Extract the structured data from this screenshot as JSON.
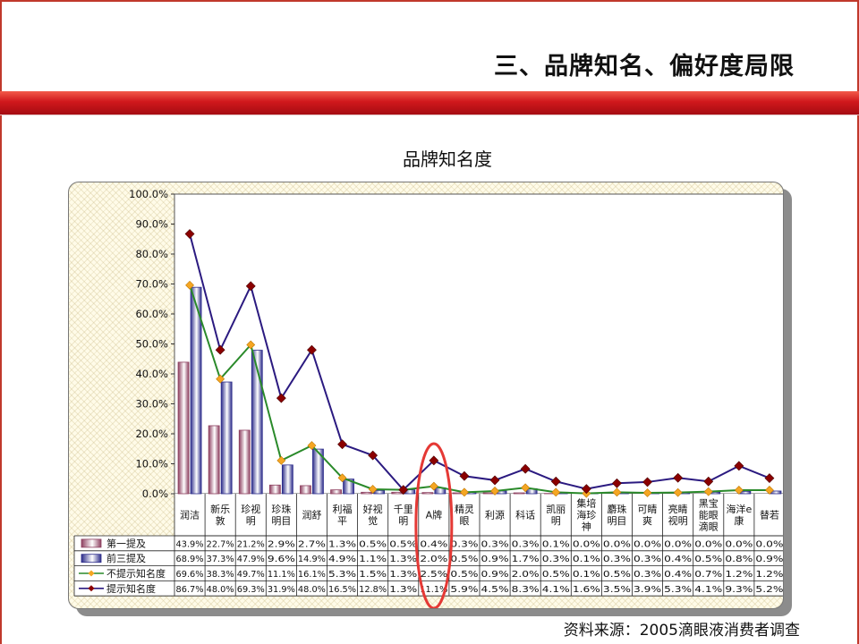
{
  "slide": {
    "title": "三、品牌知名、偏好度局限",
    "source": "资料来源：2005滴眼液消费者调查"
  },
  "colors": {
    "frame": "#c0392b",
    "title_bar": "#d0181c",
    "bar_first": "#8e4060",
    "bar_top3": "#2c2c8a",
    "line_unaided": "#2a8a2a",
    "marker_unaided": "#f5a623",
    "line_aided": "#2b1a80",
    "marker_aided": "#8b0000",
    "highlight": "#e53935"
  },
  "chart_data": {
    "type": "bar",
    "title": "品牌知名度",
    "categories": [
      "润洁",
      "新乐敦",
      "珍视明",
      "珍珠明目",
      "润舒",
      "利福平",
      "好视觉",
      "千里明",
      "A牌",
      "精灵眼",
      "利源",
      "科话",
      "凯丽明",
      "集培海珍神",
      "麝珠明目",
      "可睛爽",
      "亮睛视明",
      "黑宝能眼滴眼",
      "海洋e康",
      "替若"
    ],
    "category_lines": [
      [
        "润洁"
      ],
      [
        "新乐",
        "敦"
      ],
      [
        "珍视",
        "明"
      ],
      [
        "珍珠",
        "明目"
      ],
      [
        "润舒"
      ],
      [
        "利福",
        "平"
      ],
      [
        "好视",
        "觉"
      ],
      [
        "千里",
        "明"
      ],
      [
        "A牌"
      ],
      [
        "精灵",
        "眼"
      ],
      [
        "利源"
      ],
      [
        "科话"
      ],
      [
        "凯丽",
        "明"
      ],
      [
        "集培",
        "海珍",
        "神"
      ],
      [
        "麝珠",
        "明目"
      ],
      [
        "可睛",
        "爽"
      ],
      [
        "亮睛",
        "视明"
      ],
      [
        "黑宝",
        "能眼",
        "滴眼"
      ],
      [
        "海洋e",
        "康"
      ],
      [
        "替若"
      ]
    ],
    "ylim": [
      0,
      100
    ],
    "yticks": [
      "0.0%",
      "10.0%",
      "20.0%",
      "30.0%",
      "40.0%",
      "50.0%",
      "60.0%",
      "70.0%",
      "80.0%",
      "90.0%",
      "100.0%"
    ],
    "series": [
      {
        "name": "第一提及",
        "kind": "bar",
        "values": [
          43.9,
          22.7,
          21.2,
          2.9,
          2.7,
          1.3,
          0.5,
          0.5,
          0.4,
          0.3,
          0.3,
          0.3,
          0.1,
          0.0,
          0.0,
          0.0,
          0.0,
          0.0,
          0.0,
          0.0
        ],
        "labels": [
          "43.9%",
          "22.7%",
          "21.2%",
          "2.9%",
          "2.7%",
          "1.3%",
          "0.5%",
          "0.5%",
          "0.4%",
          "0.3%",
          "0.3%",
          "0.3%",
          "0.1%",
          "0.0%",
          "0.0%",
          "0.0%",
          "0.0%",
          "0.0%",
          "0.0%",
          "0.0%"
        ]
      },
      {
        "name": "前三提及",
        "kind": "bar",
        "values": [
          68.9,
          37.3,
          47.9,
          9.6,
          14.9,
          4.9,
          1.1,
          1.3,
          2.0,
          0.5,
          0.9,
          1.7,
          0.3,
          0.1,
          0.3,
          0.3,
          0.4,
          0.5,
          0.8,
          0.9
        ],
        "labels": [
          "68.9%",
          "37.3%",
          "47.9%",
          "9.6%",
          "14.9%",
          "4.9%",
          "1.1%",
          "1.3%",
          "2.0%",
          "0.5%",
          "0.9%",
          "1.7%",
          "0.3%",
          "0.1%",
          "0.3%",
          "0.3%",
          "0.4%",
          "0.5%",
          "0.8%",
          "0.9%"
        ]
      },
      {
        "name": "不提示知名度",
        "kind": "line",
        "values": [
          69.6,
          38.3,
          49.7,
          11.1,
          16.1,
          5.3,
          1.5,
          1.3,
          2.5,
          0.5,
          0.9,
          2.0,
          0.5,
          0.1,
          0.5,
          0.3,
          0.4,
          0.7,
          1.2,
          1.2
        ],
        "labels": [
          "69.6%",
          "38.3%",
          "49.7%",
          "11.1%",
          "16.1%",
          "5.3%",
          "1.5%",
          "1.3%",
          "2.5%",
          "0.5%",
          "0.9%",
          "2.0%",
          "0.5%",
          "0.1%",
          "0.5%",
          "0.3%",
          "0.4%",
          "0.7%",
          "1.2%",
          "1.2%"
        ]
      },
      {
        "name": "提示知名度",
        "kind": "line",
        "values": [
          86.7,
          48.0,
          69.3,
          31.9,
          48.0,
          16.5,
          12.8,
          1.3,
          11.1,
          5.9,
          4.5,
          8.3,
          4.1,
          1.6,
          3.5,
          3.9,
          5.3,
          4.1,
          9.3,
          5.2
        ],
        "labels": [
          "86.7%",
          "48.0%",
          "69.3%",
          "31.9%",
          "48.0%",
          "16.5%",
          "12.8%",
          "1.3%",
          "11.1%",
          "5.9%",
          "4.5%",
          "8.3%",
          "4.1%",
          "1.6%",
          "3.5%",
          "3.9%",
          "5.3%",
          "4.1%",
          "9.3%",
          "5.2%"
        ]
      }
    ],
    "highlight_category": "A牌",
    "legend_placement": "data-table"
  }
}
